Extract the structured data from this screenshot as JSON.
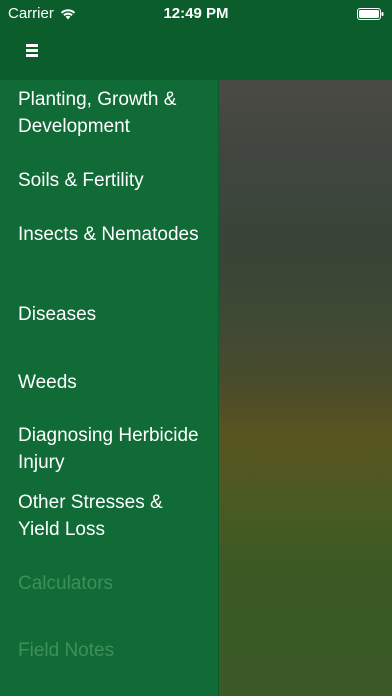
{
  "status_bar": {
    "carrier": "Carrier",
    "time": "12:49 PM"
  },
  "menu": {
    "items": [
      {
        "label": "Planting, Growth & Development",
        "enabled": true
      },
      {
        "label": "Soils & Fertility",
        "enabled": true
      },
      {
        "label": "Insects & Nematodes",
        "enabled": true
      },
      {
        "label": "Diseases",
        "enabled": true
      },
      {
        "label": "Weeds",
        "enabled": true
      },
      {
        "label": "Diagnosing Herbicide Injury",
        "enabled": true
      },
      {
        "label": "Other Stresses & Yield Loss",
        "enabled": true
      },
      {
        "label": "Calculators",
        "enabled": false
      },
      {
        "label": "Field Notes",
        "enabled": false
      }
    ]
  },
  "colors": {
    "nav_green": "#0b5e2c",
    "menu_green": "#106b37",
    "text": "#ffffff",
    "disabled_text": "#3f8f5b"
  },
  "icons": {
    "menu": "hamburger-menu-icon",
    "wifi": "wifi-icon",
    "battery": "battery-icon"
  }
}
